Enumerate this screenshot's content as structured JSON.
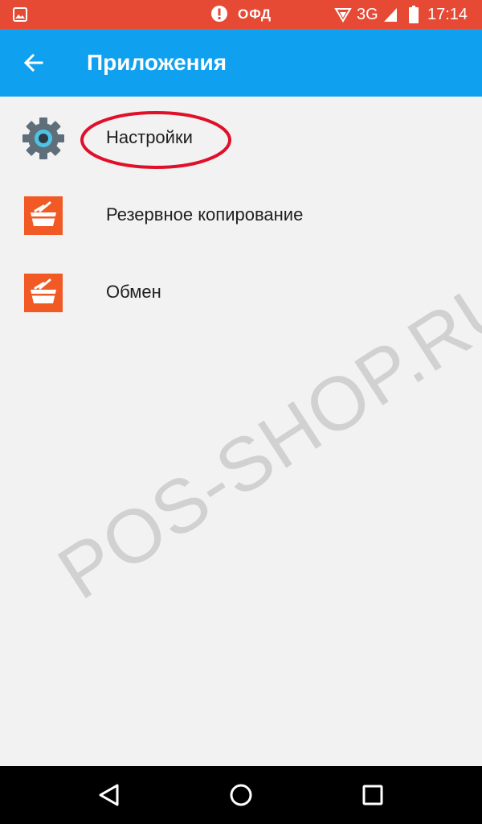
{
  "status_bar": {
    "carrier_label": "ОФД",
    "network": "3G",
    "time": "17:14",
    "background": "#e64a35"
  },
  "app_bar": {
    "title": "Приложения",
    "background": "#0fa0ef"
  },
  "items": [
    {
      "label": "Настройки",
      "icon": "settings-gear-icon",
      "highlighted": true
    },
    {
      "label": "Резервное копирование",
      "icon": "basket-app-icon"
    },
    {
      "label": "Обмен",
      "icon": "basket-app-icon"
    }
  ],
  "watermark": "POS-SHOP.RU",
  "colors": {
    "accent_orange": "#f15a24",
    "highlight_red": "#e0102a"
  },
  "nav": {
    "back_icon": "triangle-back-icon",
    "home_icon": "circle-home-icon",
    "recent_icon": "square-recent-icon"
  }
}
